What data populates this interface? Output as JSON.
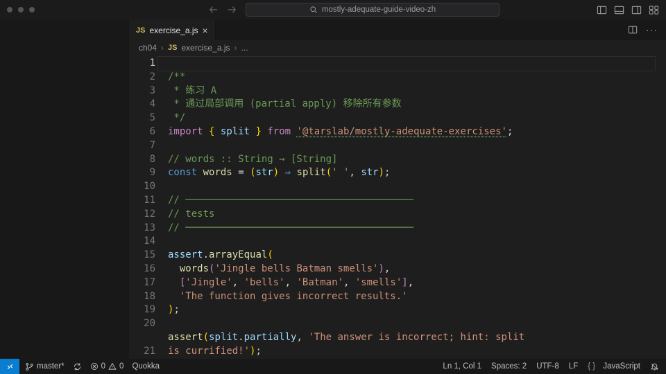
{
  "search_placeholder": "mostly-adequate-guide-video-zh",
  "tab": {
    "icon": "JS",
    "name": "exercise_a.js"
  },
  "crumbs": {
    "folder": "ch04",
    "file": "exercise_a.js",
    "sym": "..."
  },
  "gutter_current": 1,
  "code": {
    "l1": "/**",
    "l2_a": " * 练习 A",
    "l3_a": " * 通过局部调用 (partial apply) 移除所有参数",
    "l4": " */",
    "l5_import": "import",
    "l5_split": "split",
    "l5_from": "from",
    "l5_pkg": "'@tarslab/mostly-adequate-exercises'",
    "l7": "// words :: String → [String]",
    "l8_const": "const",
    "l8_words": "words",
    "l8_str": "str",
    "l8_split": "split",
    "l8_space": "' '",
    "l8_str2": "str",
    "l10": "// ───────────────────────────────────────",
    "l11": "// tests",
    "l12": "// ───────────────────────────────────────",
    "l14_assert": "assert",
    "l14_ae": "arrayEqual",
    "l15_words": "words",
    "l15_arg": "'Jingle bells Batman smells'",
    "l16_a": "'Jingle'",
    "l16_b": "'bells'",
    "l16_c": "'Batman'",
    "l16_d": "'smells'",
    "l17": "'The function gives incorrect results.'",
    "l20_assert": "assert",
    "l20_split": "split",
    "l20_part": "partially",
    "l20_msg1": "'The answer is incorrect; hint: split\nis currified!'",
    "l20_msg_a": "'The answer is incorrect; hint: split ",
    "l20_msg_b": "is currified!'"
  },
  "status": {
    "branch": "master*",
    "sync": "",
    "errors": "0",
    "warnings": "0",
    "quokka": "Quokka",
    "lncol": "Ln 1, Col 1",
    "spaces": "Spaces: 2",
    "encoding": "UTF-8",
    "eol": "LF",
    "lang": "JavaScript"
  }
}
